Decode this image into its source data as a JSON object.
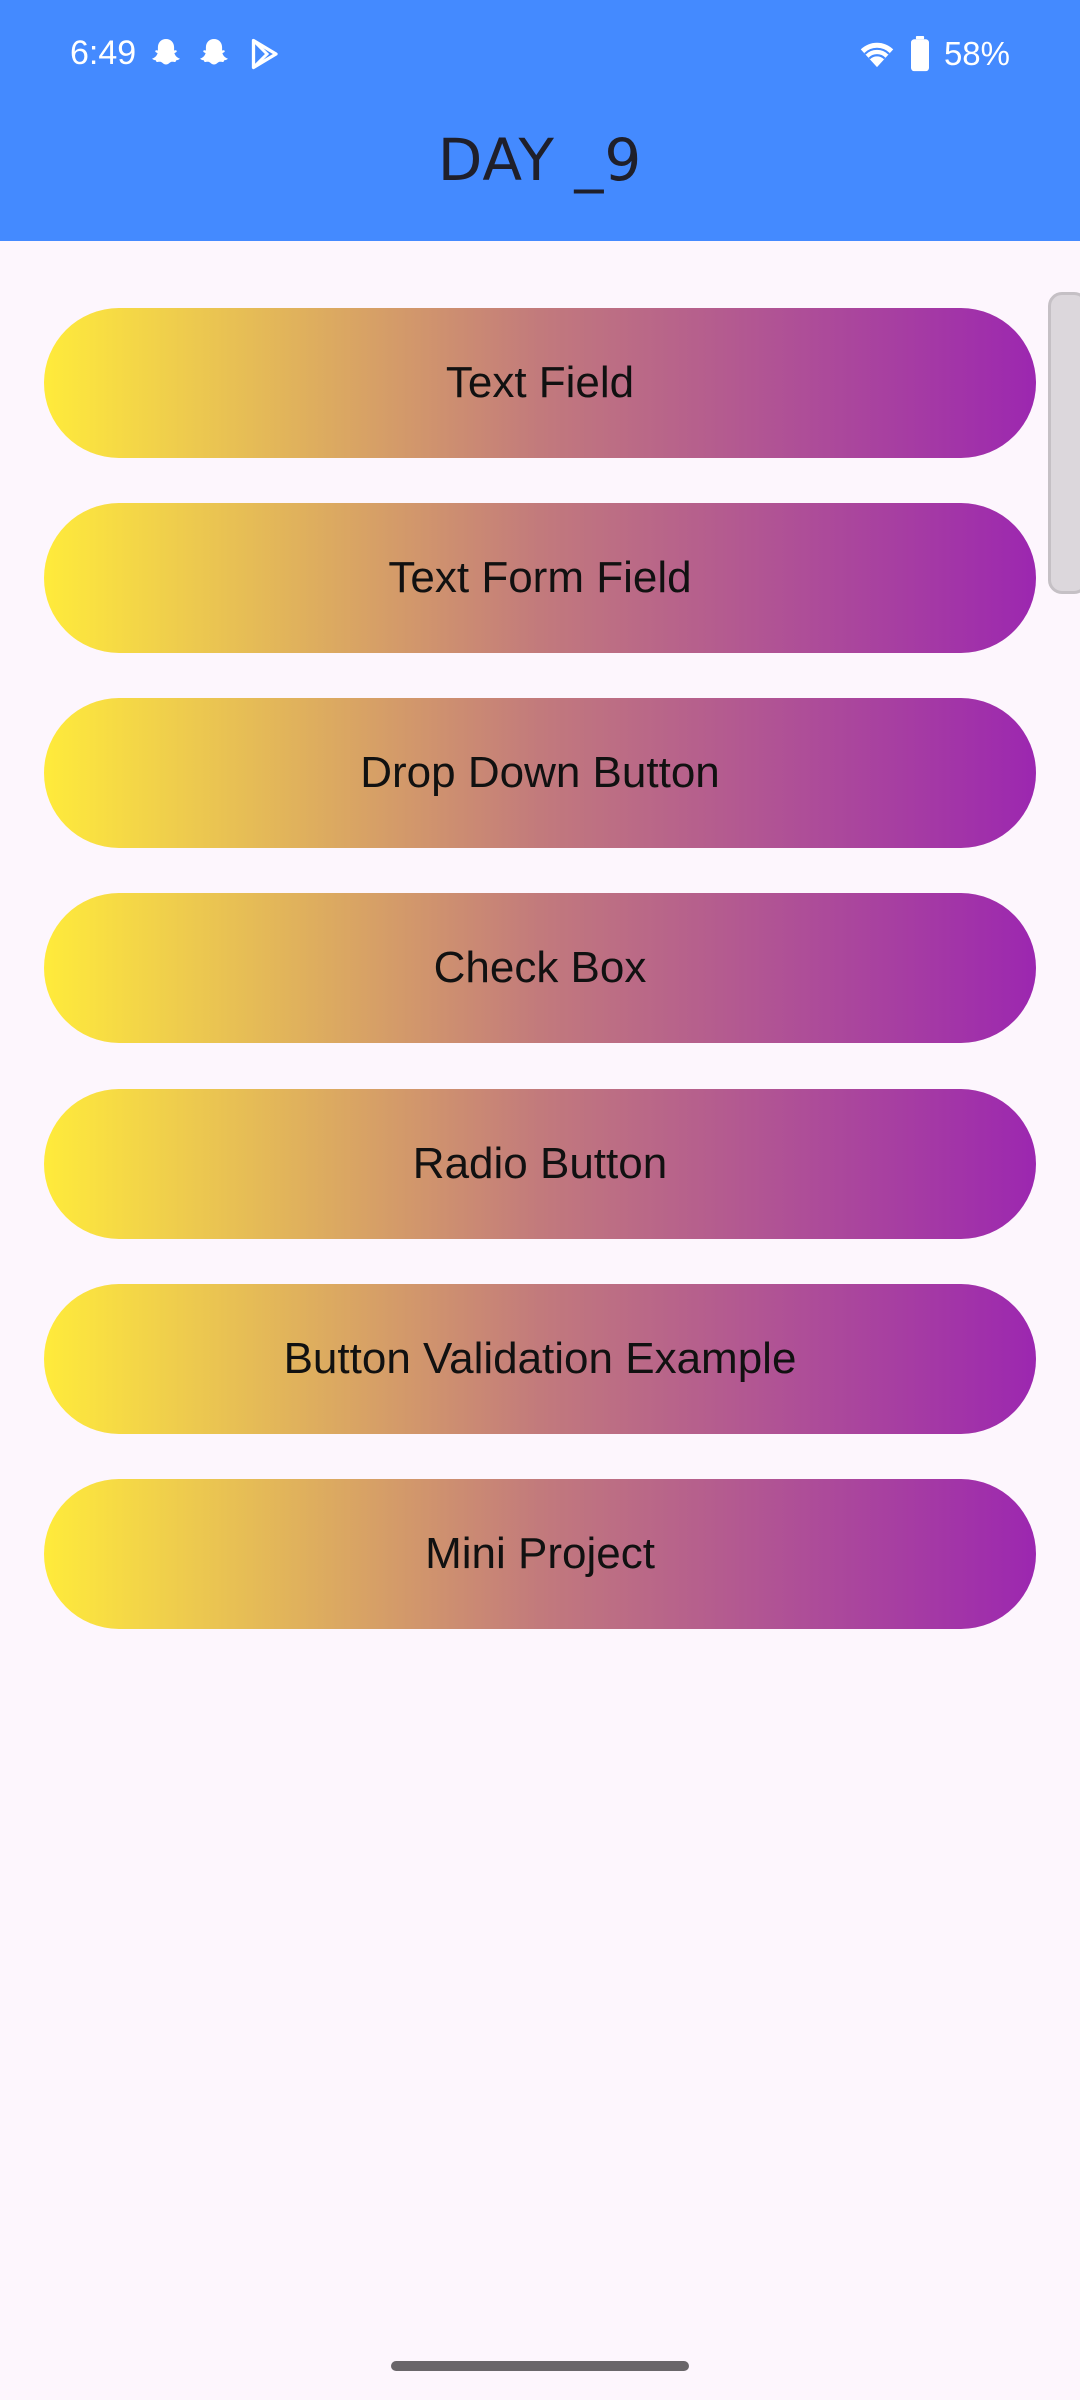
{
  "status_bar": {
    "time": "6:49",
    "battery": "58%",
    "left_icons": [
      "snapchat-icon",
      "snapchat-icon",
      "play-store-icon"
    ],
    "right_icons": [
      "wifi-icon",
      "battery-icon"
    ]
  },
  "app_bar": {
    "title": "DAY _9",
    "background_color": "#448aff"
  },
  "menu": {
    "gradient": [
      "#ffeb3b",
      "#9c27b0"
    ],
    "items": [
      {
        "label": "Text Field"
      },
      {
        "label": "Text Form Field"
      },
      {
        "label": "Drop Down Button"
      },
      {
        "label": "Check Box"
      },
      {
        "label": "Radio Button"
      },
      {
        "label": "Button Validation Example"
      },
      {
        "label": "Mini Project"
      }
    ]
  }
}
